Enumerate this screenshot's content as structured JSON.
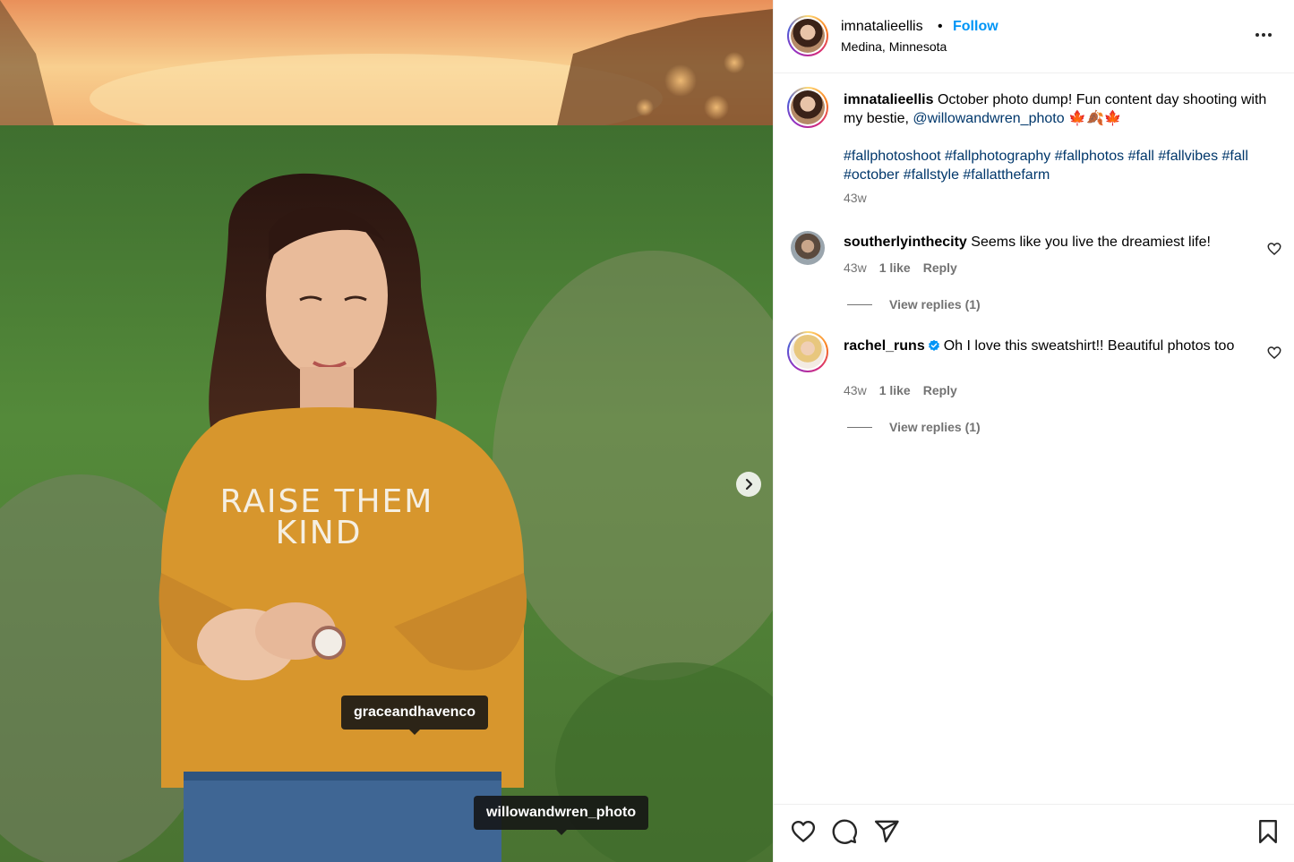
{
  "post": {
    "author": "imnatalieellis",
    "separator": "•",
    "follow_label": "Follow",
    "location": "Medina, Minnesota",
    "caption_author": "imnatalieellis",
    "caption_text": "October photo dump! Fun content day shooting with my bestie,",
    "caption_mention": "@willowandwren_photo",
    "caption_emoji": "🍁🍂🍁",
    "hashtags": "#fallphotoshoot #fallphotography #fallphotos #fall #fallvibes #fall #october #fallstyle #fallatthefarm",
    "caption_time": "43w"
  },
  "photo": {
    "sweatshirt_text_line1": "RAISE THEM",
    "sweatshirt_text_line2": "KIND",
    "tags": [
      "graceandhavenco",
      "willowandwren_photo"
    ]
  },
  "comments": [
    {
      "username": "southerlyinthecity",
      "text": "Seems like you live the dreamiest life!",
      "time": "43w",
      "likes": "1 like",
      "reply_label": "Reply",
      "view_replies": "View replies (1)",
      "verified": false
    },
    {
      "username": "rachel_runs",
      "text": "Oh I love this sweatshirt!! Beautiful photos too",
      "time": "43w",
      "likes": "1 like",
      "reply_label": "Reply",
      "view_replies": "View replies (1)",
      "verified": true
    }
  ],
  "icons": {
    "more": "more-options-icon",
    "next": "chevron-right-icon",
    "like": "heart-icon",
    "comment": "comment-icon",
    "share": "share-icon",
    "save": "bookmark-icon",
    "verified": "verified-badge-icon"
  },
  "colors": {
    "follow_blue": "#0095f6",
    "link_blue": "#00376b",
    "meta_gray": "#737373",
    "verified_blue": "#0095f6",
    "sweatshirt": "#d7962d"
  }
}
